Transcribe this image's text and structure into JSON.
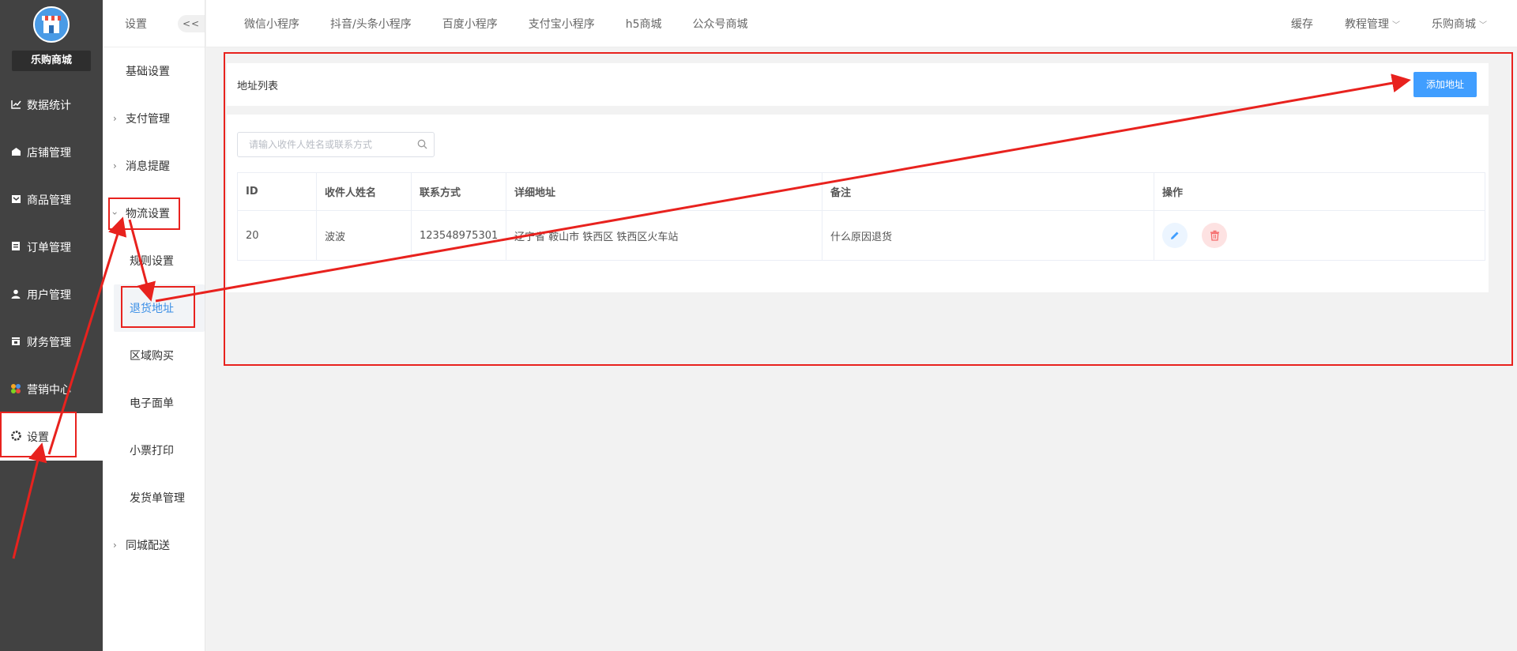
{
  "brand": {
    "name": "乐购商城"
  },
  "sidebar": {
    "items": [
      {
        "label": "数据统计",
        "icon": "chart-line-icon"
      },
      {
        "label": "店铺管理",
        "icon": "store-icon"
      },
      {
        "label": "商品管理",
        "icon": "product-icon"
      },
      {
        "label": "订单管理",
        "icon": "order-icon"
      },
      {
        "label": "用户管理",
        "icon": "user-icon"
      },
      {
        "label": "财务管理",
        "icon": "finance-icon"
      },
      {
        "label": "营销中心",
        "icon": "marketing-icon"
      },
      {
        "label": "设置",
        "icon": "gear-icon"
      }
    ]
  },
  "submenu": {
    "title": "设置",
    "collapse": "<<",
    "items": [
      {
        "label": "基础设置"
      },
      {
        "label": "支付管理"
      },
      {
        "label": "消息提醒"
      },
      {
        "label": "物流设置"
      },
      {
        "label": "规则设置"
      },
      {
        "label": "退货地址"
      },
      {
        "label": "区域购买"
      },
      {
        "label": "电子面单"
      },
      {
        "label": "小票打印"
      },
      {
        "label": "发货单管理"
      },
      {
        "label": "同城配送"
      }
    ]
  },
  "topnav": {
    "tabs": [
      "微信小程序",
      "抖音/头条小程序",
      "百度小程序",
      "支付宝小程序",
      "h5商城",
      "公众号商城"
    ],
    "right": [
      "缓存",
      "教程管理",
      "乐购商城"
    ]
  },
  "panel": {
    "title": "地址列表",
    "add_button": "添加地址",
    "search_placeholder": "请输入收件人姓名或联系方式"
  },
  "table": {
    "headers": [
      "ID",
      "收件人姓名",
      "联系方式",
      "详细地址",
      "备注",
      "操作"
    ],
    "rows": [
      {
        "id": "20",
        "name": "波波",
        "phone": "123548975301",
        "address": "辽宁省 鞍山市 铁西区 铁西区火车站",
        "remark": "什么原因退货"
      }
    ]
  },
  "colors": {
    "primary": "#409eff",
    "sidebar": "#424242",
    "annotation": "#e8221e"
  }
}
